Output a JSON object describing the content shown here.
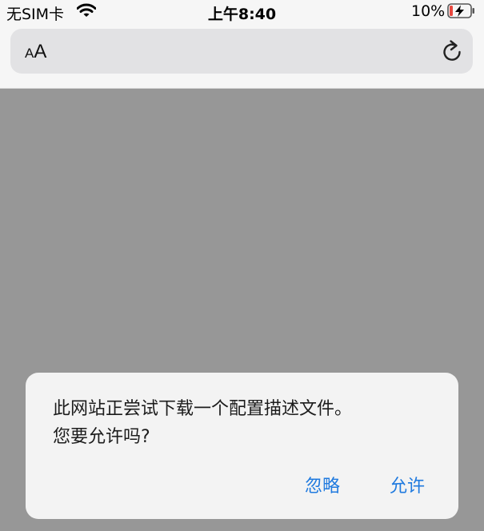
{
  "status_bar": {
    "carrier": "无SIM卡",
    "time": "上午8:40",
    "battery_percent": "10%",
    "wifi_icon": "wifi-icon",
    "battery_icon": "battery-charging-icon",
    "battery_color": "#e8473e"
  },
  "address_bar": {
    "text_size_label_small": "A",
    "text_size_label_large": "A",
    "reload_icon": "reload-icon"
  },
  "alert": {
    "message_line1": "此网站正尝试下载一个配置描述文件。",
    "message_line2": "您要允许吗?",
    "ignore_label": "忽略",
    "allow_label": "允许",
    "button_color": "#1f7adf"
  }
}
